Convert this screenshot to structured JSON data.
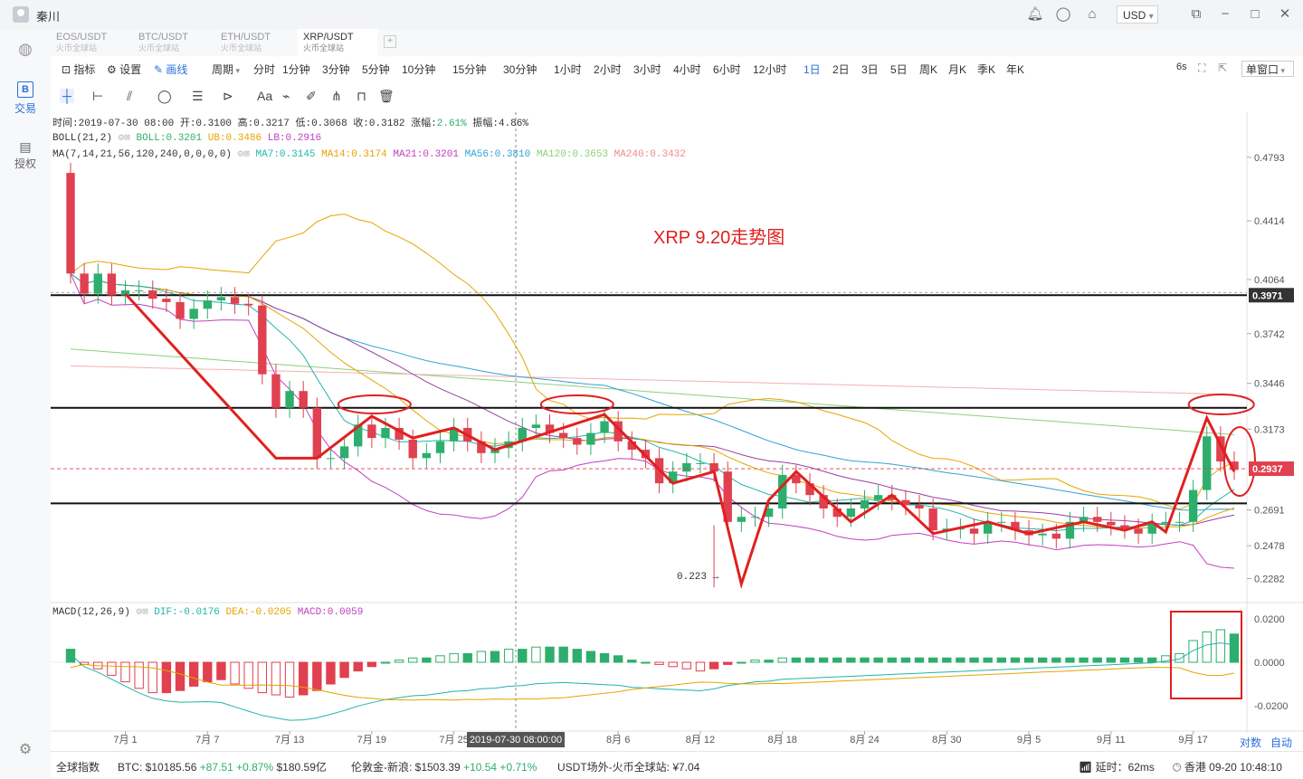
{
  "titlebar": {
    "username": "秦川",
    "currency": "USD",
    "currency_arrow": "▾"
  },
  "sidebar": {
    "trade_label": "交易",
    "authorize_label": "授权",
    "trade_icon": "B"
  },
  "tabs": [
    {
      "pair": "EOS/USDT",
      "exchange": "火币全球站"
    },
    {
      "pair": "BTC/USDT",
      "exchange": "火币全球站"
    },
    {
      "pair": "ETH/USDT",
      "exchange": "火币全球站"
    },
    {
      "pair": "XRP/USDT",
      "exchange": "火币全球站"
    }
  ],
  "toolbar": {
    "indicator": "指标",
    "settings": "设置",
    "draw": "画线",
    "period": "周期",
    "periods": [
      "分时",
      "1分钟",
      "3分钟",
      "5分钟",
      "10分钟",
      "15分钟",
      "30分钟",
      "1小时",
      "2小时",
      "3小时",
      "4小时",
      "6小时",
      "12小时",
      "1日",
      "2日",
      "3日",
      "5日",
      "周K",
      "月K",
      "季K",
      "年K"
    ],
    "active_period": "1日",
    "refresh": "6s",
    "window_mode": "单窗口"
  },
  "info": {
    "time": "时间:2019-07-30 08:00",
    "open": "开:0.3100",
    "high": "高:0.3217",
    "low": "低:0.3068",
    "close": "收:0.3182",
    "change_label": "涨幅:",
    "change": "2.61%",
    "amplitude": "振幅:4.86%",
    "boll_name": "BOLL(21,2)",
    "boll": "BOLL:0.3201",
    "ub": "UB:0.3486",
    "lb": "LB:0.2916",
    "ma_name": "MA(7,14,21,56,120,240,0,0,0,0)",
    "ma7": "MA7:0.3145",
    "ma14": "MA14:0.3174",
    "ma21": "MA21:0.3201",
    "ma56": "MA56:0.3810",
    "ma120": "MA120:0.3653",
    "ma240": "MA240:0.3432",
    "macd_name": "MACD(12,26,9)",
    "dif": "DIF:-0.0176",
    "dea": "DEA:-0.0205",
    "macd": "MACD:0.0059"
  },
  "annotation": "XRP  9.20走势图",
  "low_marker": "0.223",
  "price_axis": [
    "0.4793",
    "0.4414",
    "0.4064",
    "0.3742",
    "0.3446",
    "0.3173",
    "0.2691",
    "0.2478",
    "0.2282"
  ],
  "price_tags": {
    "upper": "0.3971",
    "current": "0.2937"
  },
  "macd_axis": [
    "0.0200",
    "0.0000",
    "-0.0200"
  ],
  "date_axis": [
    "7月 1",
    "7月 7",
    "7月 13",
    "7月 19",
    "7月 25",
    "8月 6",
    "8月 12",
    "8月 18",
    "8月 24",
    "8月 30",
    "9月 5",
    "9月 11",
    "9月 17"
  ],
  "crosshair_date": "2019-07-30 08:00:00",
  "axis_controls": {
    "log": "对数",
    "auto": "自动"
  },
  "bottom": {
    "global_index": "全球指数",
    "btc_label": "BTC: $10185.56",
    "btc_change": "+87.51 +0.87%",
    "btc_volume": "$180.59亿",
    "gold_label": "伦敦金-新浪: $1503.39",
    "gold_change": "+10.54 +0.71%",
    "usdt_label": "USDT场外-火币全球站: ¥7.04",
    "latency": "延时：62ms",
    "clock": "香港 09-20 10:48:10"
  },
  "chart_data": {
    "type": "candlestick",
    "title": "",
    "x": [
      "06-27",
      "06-28",
      "06-29",
      "06-30",
      "07-01",
      "07-02",
      "07-03",
      "07-04",
      "07-05",
      "07-06",
      "07-07",
      "07-08",
      "07-09",
      "07-10",
      "07-11",
      "07-12",
      "07-13",
      "07-14",
      "07-15",
      "07-16",
      "07-17",
      "07-18",
      "07-19",
      "07-20",
      "07-21",
      "07-22",
      "07-23",
      "07-24",
      "07-25",
      "07-26",
      "07-27",
      "07-28",
      "07-29",
      "07-30",
      "07-31",
      "08-01",
      "08-02",
      "08-03",
      "08-04",
      "08-05",
      "08-06",
      "08-07",
      "08-08",
      "08-09",
      "08-10",
      "08-11",
      "08-12",
      "08-13",
      "08-14",
      "08-15",
      "08-16",
      "08-17",
      "08-18",
      "08-19",
      "08-20",
      "08-21",
      "08-22",
      "08-23",
      "08-24",
      "08-25",
      "08-26",
      "08-27",
      "08-28",
      "08-29",
      "08-30",
      "08-31",
      "09-01",
      "09-02",
      "09-03",
      "09-04",
      "09-05",
      "09-06",
      "09-07",
      "09-08",
      "09-09",
      "09-10",
      "09-11",
      "09-12",
      "09-13",
      "09-14",
      "09-15",
      "09-16",
      "09-17",
      "09-18",
      "09-19",
      "09-20"
    ],
    "open": [
      0.47,
      0.41,
      0.398,
      0.41,
      0.397,
      0.4,
      0.4,
      0.395,
      0.393,
      0.383,
      0.389,
      0.394,
      0.396,
      0.392,
      0.391,
      0.35,
      0.33,
      0.34,
      0.33,
      0.3,
      0.3,
      0.307,
      0.32,
      0.312,
      0.318,
      0.311,
      0.3,
      0.303,
      0.31,
      0.318,
      0.31,
      0.303,
      0.306,
      0.31,
      0.318,
      0.32,
      0.315,
      0.312,
      0.308,
      0.315,
      0.322,
      0.31,
      0.305,
      0.3,
      0.285,
      0.292,
      0.297,
      0.297,
      0.292,
      0.262,
      0.265,
      0.265,
      0.27,
      0.29,
      0.285,
      0.278,
      0.27,
      0.265,
      0.27,
      0.275,
      0.278,
      0.275,
      0.272,
      0.27,
      0.257,
      0.258,
      0.258,
      0.255,
      0.262,
      0.262,
      0.257,
      0.254,
      0.255,
      0.252,
      0.262,
      0.265,
      0.262,
      0.26,
      0.258,
      0.255,
      0.261,
      0.262,
      0.262,
      0.281,
      0.313,
      0.298
    ],
    "close": [
      0.41,
      0.398,
      0.41,
      0.397,
      0.4,
      0.4,
      0.395,
      0.393,
      0.383,
      0.389,
      0.394,
      0.396,
      0.392,
      0.391,
      0.35,
      0.33,
      0.34,
      0.33,
      0.3,
      0.3,
      0.307,
      0.32,
      0.312,
      0.318,
      0.311,
      0.3,
      0.303,
      0.31,
      0.318,
      0.31,
      0.303,
      0.306,
      0.31,
      0.318,
      0.32,
      0.315,
      0.312,
      0.308,
      0.315,
      0.322,
      0.31,
      0.305,
      0.3,
      0.285,
      0.292,
      0.297,
      0.297,
      0.292,
      0.262,
      0.265,
      0.265,
      0.27,
      0.29,
      0.285,
      0.278,
      0.27,
      0.265,
      0.27,
      0.275,
      0.278,
      0.275,
      0.272,
      0.27,
      0.257,
      0.258,
      0.258,
      0.255,
      0.262,
      0.262,
      0.257,
      0.254,
      0.255,
      0.252,
      0.262,
      0.265,
      0.262,
      0.26,
      0.258,
      0.255,
      0.261,
      0.262,
      0.262,
      0.281,
      0.313,
      0.298,
      0.293
    ],
    "ylim": [
      0.215,
      0.49
    ],
    "low_marker": 0.223,
    "horizontal_lines": [
      0.3971,
      0.33,
      0.273
    ],
    "current_price": 0.2937,
    "macd_histogram": [
      0.006,
      -0.001,
      -0.003,
      -0.006,
      -0.009,
      -0.012,
      -0.014,
      -0.014,
      -0.013,
      -0.011,
      -0.009,
      -0.008,
      -0.01,
      -0.012,
      -0.014,
      -0.015,
      -0.016,
      -0.015,
      -0.013,
      -0.01,
      -0.007,
      -0.004,
      -0.002,
      0.0,
      0.001,
      0.002,
      0.002,
      0.003,
      0.004,
      0.004,
      0.005,
      0.005,
      0.006,
      0.006,
      0.007,
      0.007,
      0.007,
      0.006,
      0.005,
      0.004,
      0.003,
      0.001,
      0.0,
      -0.001,
      -0.002,
      -0.003,
      -0.004,
      -0.003,
      -0.001,
      0.0,
      0.001,
      0.001,
      0.002,
      0.002,
      0.002,
      0.002,
      0.002,
      0.002,
      0.002,
      0.002,
      0.002,
      0.002,
      0.002,
      0.002,
      0.002,
      0.002,
      0.002,
      0.002,
      0.002,
      0.002,
      0.002,
      0.002,
      0.002,
      0.002,
      0.002,
      0.002,
      0.002,
      0.002,
      0.002,
      0.002,
      0.003,
      0.004,
      0.01,
      0.014,
      0.015,
      0.013
    ],
    "macd_ylim": [
      -0.03,
      0.025
    ]
  }
}
